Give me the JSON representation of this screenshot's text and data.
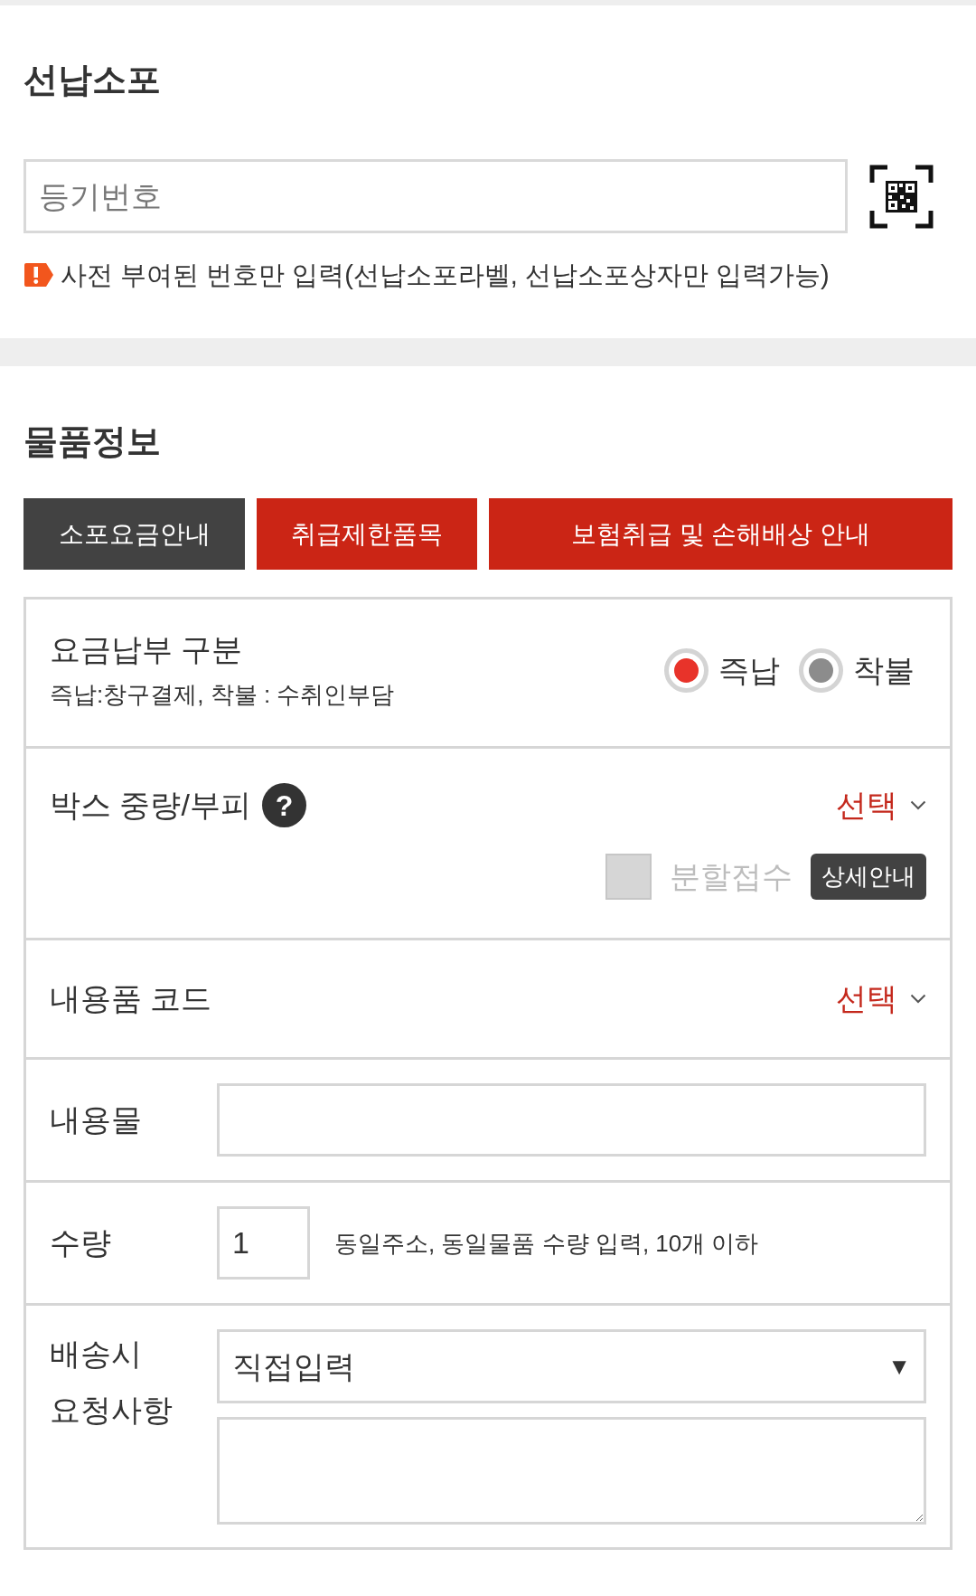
{
  "prepaid_parcel": {
    "title": "선납소포",
    "registration_field": {
      "placeholder": "등기번호"
    },
    "notice": "사전 부여된 번호만 입력(선납소포라벨, 선납소포상자만 입력가능)"
  },
  "item_info": {
    "title": "물품정보",
    "tabs": [
      {
        "label": "소포요금안내",
        "selected": true
      },
      {
        "label": "취급제한품목",
        "selected": false
      },
      {
        "label": "보험취급 및 손해배상 안내",
        "selected": false
      }
    ],
    "rows": [
      {
        "kind": "radio",
        "label": "요금납부 구분",
        "description": "즉납:창구결제, 착불 : 수취인부담",
        "options": [
          {
            "label": "즉납",
            "selected": true
          },
          {
            "label": "착불",
            "selected": false
          }
        ]
      },
      {
        "kind": "picker",
        "label": "박스 중량/부피",
        "help": "?",
        "value": "선택",
        "split": {
          "label": "분할접수",
          "checked": false,
          "disabled": true
        },
        "detail_button": "상세안내"
      },
      {
        "kind": "picker",
        "label": "내용품 코드",
        "value": "선택"
      },
      {
        "kind": "text",
        "label": "내용물"
      },
      {
        "kind": "quantity",
        "label": "수량",
        "value": "1",
        "hint": "동일주소, 동일물품 수량 입력, 10개 이하"
      },
      {
        "kind": "request",
        "label": "배송시 요청사항",
        "select": {
          "value": "직접입력",
          "arrow": "▼"
        }
      }
    ]
  }
}
